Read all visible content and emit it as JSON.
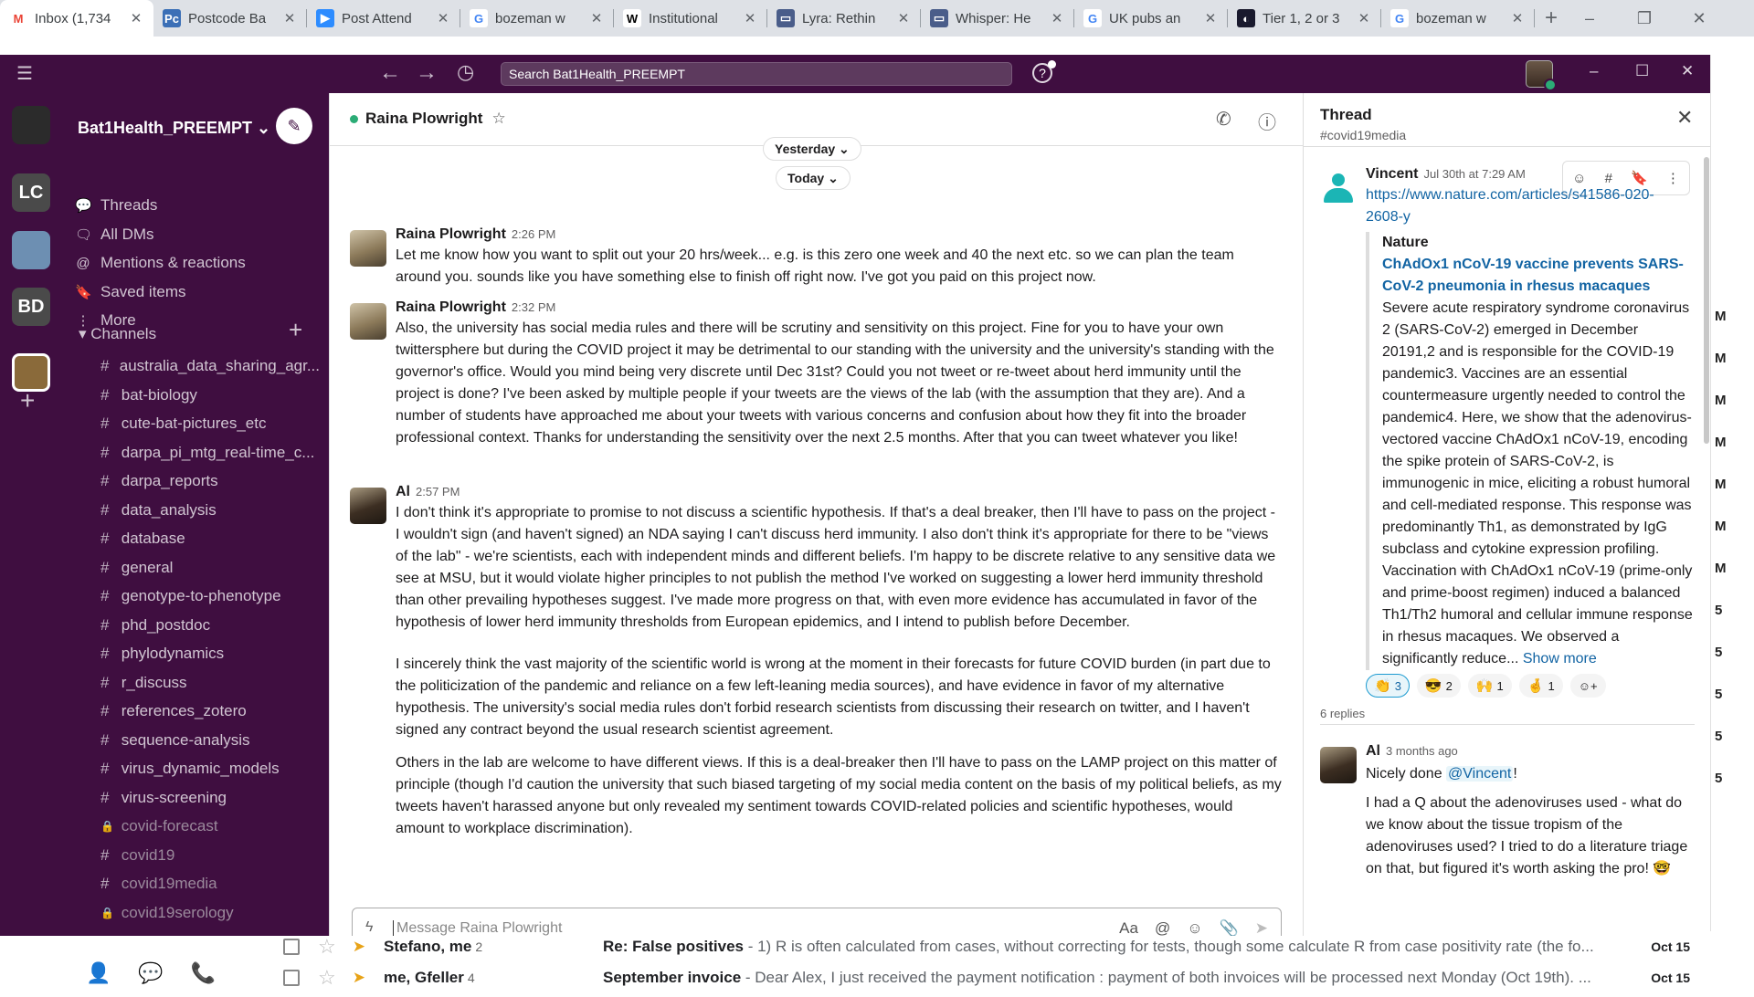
{
  "browser": {
    "tabs": [
      {
        "label": "Inbox (1,734",
        "fav": "M",
        "fav_color": "#ea4335",
        "fav_bg": "#ffffff",
        "active": true
      },
      {
        "label": "Postcode Ba",
        "fav": "Pc",
        "fav_color": "#ffffff",
        "fav_bg": "#3b6fb6"
      },
      {
        "label": "Post Attend",
        "fav": "▶",
        "fav_color": "#ffffff",
        "fav_bg": "#2d8cff"
      },
      {
        "label": "bozeman w",
        "fav": "G",
        "fav_color": "#4285f4",
        "fav_bg": "#ffffff"
      },
      {
        "label": "Institutional",
        "fav": "W",
        "fav_color": "#000000",
        "fav_bg": "#ffffff"
      },
      {
        "label": "Lyra: Rethin",
        "fav": "▭",
        "fav_color": "#ffffff",
        "fav_bg": "#4a5d8a"
      },
      {
        "label": "Whisper: He",
        "fav": "▭",
        "fav_color": "#ffffff",
        "fav_bg": "#4a5d8a"
      },
      {
        "label": "UK pubs an",
        "fav": "G",
        "fav_color": "#4285f4",
        "fav_bg": "#ffffff"
      },
      {
        "label": "Tier 1, 2 or 3",
        "fav": "◐",
        "fav_color": "#ffffff",
        "fav_bg": "#1a1a2e"
      },
      {
        "label": "bozeman w",
        "fav": "G",
        "fav_color": "#4285f4",
        "fav_bg": "#ffffff"
      }
    ],
    "new_tab": "+",
    "window_controls": [
      "–",
      "❐",
      "✕"
    ]
  },
  "slack": {
    "search_placeholder": "Search Bat1Health_PREEMPT",
    "window_controls": [
      "–",
      "☐",
      "✕"
    ],
    "workspaces": [
      {
        "label": "",
        "bg": "#2b2b2b"
      },
      {
        "label": "LC",
        "bg": "#4a4a4a"
      },
      {
        "label": "",
        "bg": "#6d8fb2"
      },
      {
        "label": "BD",
        "bg": "#4a4a4a"
      },
      {
        "label": "",
        "bg": "#8a6a3a"
      }
    ],
    "workspace_name": "Bat1Health_PREEMPT ⌄",
    "nav": [
      {
        "icon": "💬",
        "label": "Threads"
      },
      {
        "icon": "🗨",
        "label": "All DMs"
      },
      {
        "icon": "@",
        "label": "Mentions & reactions"
      },
      {
        "icon": "🔖",
        "label": "Saved items"
      },
      {
        "icon": "⋮",
        "label": "More"
      }
    ],
    "channels_header": "▾   Channels",
    "channels": [
      {
        "name": "australia_data_sharing_agr...",
        "prefix": "#",
        "muted": false
      },
      {
        "name": "bat-biology",
        "prefix": "#",
        "muted": false
      },
      {
        "name": "cute-bat-pictures_etc",
        "prefix": "#",
        "muted": false
      },
      {
        "name": "darpa_pi_mtg_real-time_c...",
        "prefix": "#",
        "muted": false
      },
      {
        "name": "darpa_reports",
        "prefix": "#",
        "muted": false
      },
      {
        "name": "data_analysis",
        "prefix": "#",
        "muted": false
      },
      {
        "name": "database",
        "prefix": "#",
        "muted": false
      },
      {
        "name": "general",
        "prefix": "#",
        "muted": false
      },
      {
        "name": "genotype-to-phenotype",
        "prefix": "#",
        "muted": false
      },
      {
        "name": "phd_postdoc",
        "prefix": "#",
        "muted": false
      },
      {
        "name": "phylodynamics",
        "prefix": "#",
        "muted": false
      },
      {
        "name": "r_discuss",
        "prefix": "#",
        "muted": false
      },
      {
        "name": "references_zotero",
        "prefix": "#",
        "muted": false
      },
      {
        "name": "sequence-analysis",
        "prefix": "#",
        "muted": false
      },
      {
        "name": "virus_dynamic_models",
        "prefix": "#",
        "muted": false
      },
      {
        "name": "virus-screening",
        "prefix": "#",
        "muted": false
      },
      {
        "name": "covid-forecast",
        "prefix": "🔒",
        "muted": true
      },
      {
        "name": "covid19",
        "prefix": "#",
        "muted": true
      },
      {
        "name": "covid19media",
        "prefix": "#",
        "muted": true
      },
      {
        "name": "covid19serology",
        "prefix": "🔒",
        "muted": true
      }
    ],
    "conversation": {
      "title": "Raina Plowright",
      "date_pills": [
        "Yesterday ⌄",
        "Today ⌄"
      ],
      "messages": [
        {
          "author": "Raina Plowright",
          "time": "2:26 PM",
          "paragraphs": [
            "Let me know how you want to split out your 20 hrs/week... e.g. is this zero one week and 40 the next etc. so we can plan the team around you. sounds like you have something else to finish off right now. I've got you paid on this project now."
          ]
        },
        {
          "author": "Raina Plowright",
          "time": "2:32 PM",
          "paragraphs": [
            "Also, the university has social media rules and there will be scrutiny and sensitivity on this project. Fine for you to have your own twittersphere but during the COVID project it may be detrimental to our standing with the university and the university's standing with the governor's office. Would you mind being very discrete until Dec 31st? Could you not tweet or re-tweet about herd immunity until the project is done? I've been asked by multiple people  if your tweets are the views of the lab (with the assumption that they are). And a number of students have approached me about your tweets with various concerns and confusion about how they fit into the broader professional context. Thanks for understanding the sensitivity over the next 2.5 months. After that you can tweet whatever you like!"
          ]
        },
        {
          "author": "Al",
          "time": "2:57 PM",
          "paragraphs": [
            "I don't think it's appropriate to promise to not discuss a scientific hypothesis. If that's a deal breaker, then I'll have to pass on the project - I wouldn't sign (and haven't signed) an NDA saying I can't discuss herd immunity. I also don't think it's appropriate for there to be \"views of the lab\" - we're scientists, each with independent minds and different beliefs. I'm happy to be discrete relative to any sensitive data we see at MSU, but it would violate higher principles to not publish the method I've worked on suggesting a lower herd immunity threshold than other prevailing hypotheses suggest. I've made more progress on that, with even more evidence has accumulated in favor of the hypothesis of lower herd immunity thresholds from European epidemics, and I intend to publish before December.",
            "I sincerely think the vast majority of the scientific world is wrong at the moment in their forecasts for future COVID burden (in part due to the politicization of the pandemic and reliance on a few left-leaning media sources), and have evidence in favor of my alternative hypothesis. The university's social media rules don't forbid research scientists from discussing their research on twitter, and I haven't signed any contract beyond the usual research scientist agreement.",
            "Others in the lab are welcome to have different views. If this is a deal-breaker then I'll have to pass on the LAMP project on this matter of principle (though I'd caution the university that such biased targeting of my social media content on the basis of my political beliefs, as my tweets haven't harassed anyone but only revealed my sentiment towards COVID-related policies and scientific hypotheses, would amount to workplace discrimination)."
          ]
        }
      ],
      "composer_placeholder": "Message Raina Plowright",
      "composer_tools": [
        "Aa",
        "@",
        "☺",
        "📎",
        "➤"
      ]
    },
    "thread": {
      "title": "Thread",
      "channel": "#covid19media",
      "parent": {
        "author": "Vincent",
        "time": "Jul 30th at 7:29 AM",
        "link": "https://www.nature.com/articles/s41586-020-2608-y",
        "unfurl_source": "Nature",
        "unfurl_title": "ChAdOx1 nCoV-19 vaccine prevents SARS-CoV-2 pneumonia in rhesus macaques",
        "unfurl_desc": "Severe acute respiratory syndrome coronavirus 2 (SARS-CoV-2) emerged in December 20191,2 and is responsible for the COVID-19 pandemic3. Vaccines are an essential countermeasure urgently needed to control the pandemic4. Here, we show that the adenovirus-vectored vaccine ChAdOx1 nCoV-19, encoding the spike protein of SARS-CoV-2, is immunogenic in mice, eliciting a robust humoral and cell-mediated response. This response was predominantly Th1, as demonstrated by IgG subclass and cytokine expression profiling. Vaccination with ChAdOx1 nCoV-19 (prime-only and prime-boost regimen) induced a balanced Th1/Th2 humoral and cellular immune response in rhesus macaques. We observed a significantly reduce...",
        "show_more": "Show more",
        "reactions": [
          {
            "emoji": "👏",
            "count": "3",
            "selected": true
          },
          {
            "emoji": "😎",
            "count": "2",
            "selected": false
          },
          {
            "emoji": "🙌",
            "count": "1",
            "selected": false
          },
          {
            "emoji": "🤞",
            "count": "1",
            "selected": false
          }
        ],
        "hover_actions": [
          "☺",
          "#",
          "🔖",
          "⋮"
        ]
      },
      "replies_label": "6 replies",
      "reply": {
        "author": "Al",
        "time": "3 months ago",
        "line1_prefix": "Nicely done ",
        "mention": "@Vincent",
        "line1_suffix": "!",
        "body": "I had a Q about the adenoviruses used - what do we know about the tissue tropism of the adenoviruses used? I tried to do a literature triage on that, but figured it's worth asking the pro! 🤓"
      }
    }
  },
  "gmail_behind": {
    "right_marks": [
      "M",
      "M",
      "M",
      "M",
      "M",
      "M",
      "M",
      "5",
      "5",
      "5",
      "5",
      "5"
    ],
    "rows": [
      {
        "sender": "Stefano, me",
        "count": "2",
        "subject": "Re: False positives",
        "snippet": " - 1) R is often calculated from cases, without correcting for tests, though some calculate R from case positivity rate (the fo...",
        "date": "Oct 15"
      },
      {
        "sender": "me, Gfeller",
        "count": "4",
        "subject": "September invoice",
        "snippet": " - Dear Alex, I just received the payment notification : payment of both invoices will be processed next Monday (Oct 19th). ...",
        "date": "Oct 15"
      }
    ]
  }
}
